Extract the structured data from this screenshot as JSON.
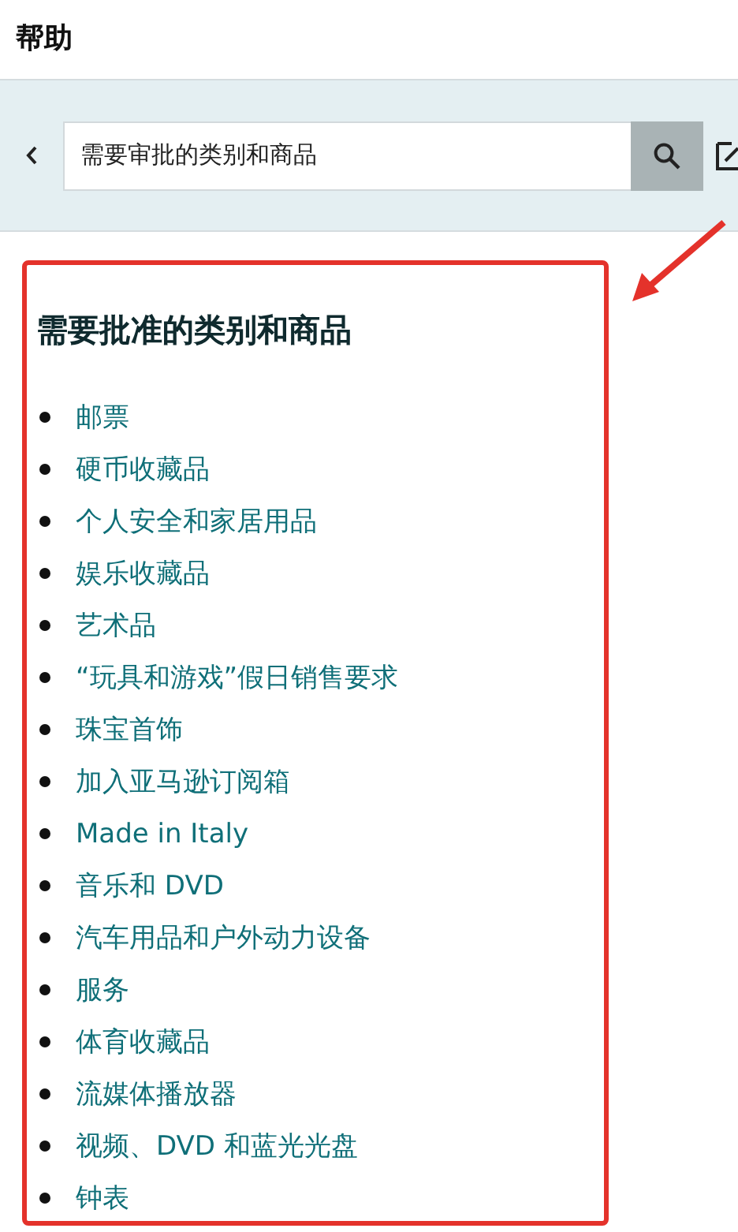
{
  "header": {
    "title": "帮助"
  },
  "search": {
    "value": "需要审批的类别和商品"
  },
  "article": {
    "heading": "需要批准的类别和商品",
    "items": [
      "邮票",
      "硬币收藏品",
      "个人安全和家居用品",
      "娱乐收藏品",
      "艺术品",
      "“玩具和游戏”假日销售要求",
      "珠宝首饰",
      "加入亚马逊订阅箱",
      "Made in Italy",
      "音乐和 DVD",
      "汽车用品和户外动力设备",
      "服务",
      "体育收藏品",
      "流媒体播放器",
      "视频、DVD 和蓝光光盘",
      "钟表"
    ]
  }
}
